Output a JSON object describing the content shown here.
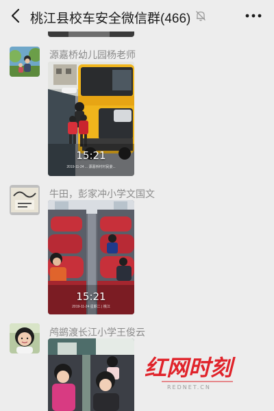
{
  "header": {
    "title": "桃江县校车安全微信群(466)",
    "back_icon": "chevron-left-icon",
    "mute_icon": "bell-off-icon",
    "more_icon": "more-icon"
  },
  "messages": [
    {
      "sender": "源嘉桥幼儿园杨老师",
      "type": "video",
      "duration": "15:21",
      "stamp": "2019-11-24 ... 源嘉桥村村民委..."
    },
    {
      "sender": "牛田，彭家冲小学文国文",
      "type": "video",
      "duration": "15:21",
      "stamp": "2019-11-24 星期二 | 桃江"
    },
    {
      "sender": "鸬鹚渡长江小学王俊云",
      "type": "video",
      "duration": ""
    }
  ],
  "watermark": {
    "brand": "红网时刻",
    "sub": "REDNET.CN",
    "color": "#e0232a"
  }
}
